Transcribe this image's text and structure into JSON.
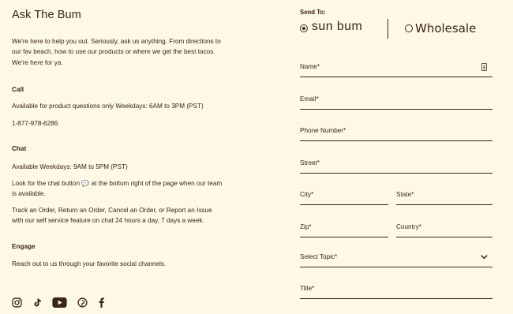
{
  "left": {
    "title": "Ask The Bum",
    "intro": "We're here to help you out. Seriously, ask us anything. From directions to our fav beach, how to use our products or where we get the best tacos. We're here for ya.",
    "call": {
      "heading": "Call",
      "availability": "Available for product questions only Weekdays: 6AM to 3PM (PST)",
      "phone": "1-877-978-6286"
    },
    "chat": {
      "heading": "Chat",
      "availability": "Available Weekdays: 9AM to 5PM (PST)",
      "look_before": "Look for the chat button",
      "look_icon": "💬",
      "look_after": "at the bottom right of the page when our team is available.",
      "self_service": "Track an Order, Return an Order, Cancel an Order, or Report an Issue with our self service feature on chat 24 hours a day, 7 days a week."
    },
    "engage": {
      "heading": "Engage",
      "text": "Reach out to us through your favorite social channels."
    },
    "social_icons": [
      "instagram-icon",
      "tiktok-icon",
      "youtube-icon",
      "pinterest-icon",
      "facebook-icon"
    ]
  },
  "form": {
    "send_to_label": "Send To:",
    "options": [
      {
        "label": "sun bum",
        "selected": true
      },
      {
        "label": "Wholesale",
        "selected": false
      }
    ],
    "fields": {
      "name": "Name*",
      "email": "Email*",
      "phone": "Phone Number*",
      "street": "Street*",
      "city": "City*",
      "state": "State*",
      "zip": "Zip*",
      "country": "Country*",
      "topic": "Select Topic*",
      "title": "Title*"
    }
  },
  "colors": {
    "background": "#fdf9e4",
    "text": "#3a2416",
    "chat_icon": "#6a9bd4"
  }
}
